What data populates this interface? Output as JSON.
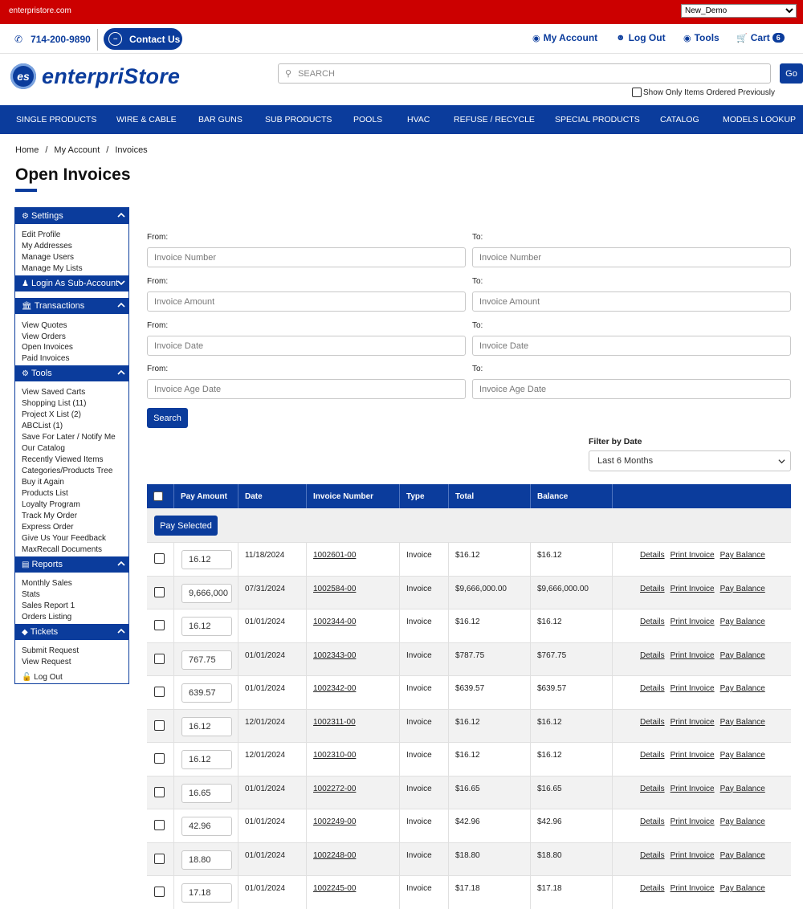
{
  "topbar": {
    "site": "enterpristore.com",
    "account_select": "New_Demo"
  },
  "header": {
    "phone": "714-200-9890",
    "contact": "Contact Us",
    "my_account": "My Account",
    "log_out": "Log Out",
    "tools": "Tools",
    "cart": "Cart",
    "cart_count": "6"
  },
  "logo": {
    "mark": "es",
    "text": "enterpriStore"
  },
  "search": {
    "placeholder": "SEARCH",
    "go": "Go",
    "only_previous": "Show Only Items Ordered Previously"
  },
  "nav": [
    "SINGLE PRODUCTS",
    "WIRE & CABLE",
    "BAR GUNS",
    "SUB PRODUCTS",
    "POOLS",
    "HVAC",
    "REFUSE / RECYCLE",
    "SPECIAL PRODUCTS",
    "CATALOG",
    "MODELS LOOKUP"
  ],
  "breadcrumb": [
    "Home",
    "My Account",
    "Invoices"
  ],
  "page_title": "Open Invoices",
  "sidebar": {
    "settings": {
      "title": "Settings",
      "links": [
        "Edit Profile",
        "My Addresses",
        "Manage Users",
        "Manage My Lists"
      ]
    },
    "login_sub": {
      "title": "Login As Sub-Account"
    },
    "transactions": {
      "title": "Transactions",
      "links": [
        "View Quotes",
        "View Orders",
        "Open Invoices",
        "Paid Invoices"
      ]
    },
    "tools": {
      "title": "Tools",
      "links": [
        "View Saved Carts",
        "Shopping List (11)",
        "Project X List (2)",
        "ABCList (1)",
        "Save For Later / Notify Me",
        "Our Catalog",
        "Recently Viewed Items",
        "Categories/Products Tree",
        "Buy it Again",
        "Products List",
        "Loyalty Program",
        "Track My Order",
        "Express Order",
        "Give Us Your Feedback",
        "MaxRecall Documents"
      ]
    },
    "reports": {
      "title": "Reports",
      "links": [
        "Monthly Sales",
        "Stats",
        "Sales Report 1",
        "Orders Listing"
      ]
    },
    "tickets": {
      "title": "Tickets",
      "links": [
        "Submit Request",
        "View Request"
      ]
    },
    "logout": "Log Out"
  },
  "filters": {
    "from_label": "From:",
    "to_label": "To:",
    "fields": [
      "Invoice Number",
      "Invoice Amount",
      "Invoice Date",
      "Invoice Age Date"
    ],
    "search_button": "Search",
    "filter_by_date_label": "Filter by Date",
    "filter_by_date_value": "Last 6 Months"
  },
  "table": {
    "headers": [
      "Pay Amount",
      "Date",
      "Invoice Number",
      "Type",
      "Total",
      "Balance"
    ],
    "pay_selected": "Pay Selected",
    "action_labels": [
      "Details",
      "Print Invoice",
      "Pay Balance"
    ],
    "rows": [
      {
        "pay": "16.12",
        "date": "11/18/2024",
        "invoice": "1002601-00",
        "type": "Invoice",
        "total": "$16.12",
        "balance": "$16.12"
      },
      {
        "pay": "9,666,000",
        "date": "07/31/2024",
        "invoice": "1002584-00",
        "type": "Invoice",
        "total": "$9,666,000.00",
        "balance": "$9,666,000.00"
      },
      {
        "pay": "16.12",
        "date": "01/01/2024",
        "invoice": "1002344-00",
        "type": "Invoice",
        "total": "$16.12",
        "balance": "$16.12"
      },
      {
        "pay": "767.75",
        "date": "01/01/2024",
        "invoice": "1002343-00",
        "type": "Invoice",
        "total": "$787.75",
        "balance": "$767.75"
      },
      {
        "pay": "639.57",
        "date": "01/01/2024",
        "invoice": "1002342-00",
        "type": "Invoice",
        "total": "$639.57",
        "balance": "$639.57"
      },
      {
        "pay": "16.12",
        "date": "12/01/2024",
        "invoice": "1002311-00",
        "type": "Invoice",
        "total": "$16.12",
        "balance": "$16.12"
      },
      {
        "pay": "16.12",
        "date": "12/01/2024",
        "invoice": "1002310-00",
        "type": "Invoice",
        "total": "$16.12",
        "balance": "$16.12"
      },
      {
        "pay": "16.65",
        "date": "01/01/2024",
        "invoice": "1002272-00",
        "type": "Invoice",
        "total": "$16.65",
        "balance": "$16.65"
      },
      {
        "pay": "42.96",
        "date": "01/01/2024",
        "invoice": "1002249-00",
        "type": "Invoice",
        "total": "$42.96",
        "balance": "$42.96"
      },
      {
        "pay": "18.80",
        "date": "01/01/2024",
        "invoice": "1002248-00",
        "type": "Invoice",
        "total": "$18.80",
        "balance": "$18.80"
      },
      {
        "pay": "17.18",
        "date": "01/01/2024",
        "invoice": "1002245-00",
        "type": "Invoice",
        "total": "$17.18",
        "balance": "$17.18"
      }
    ]
  }
}
